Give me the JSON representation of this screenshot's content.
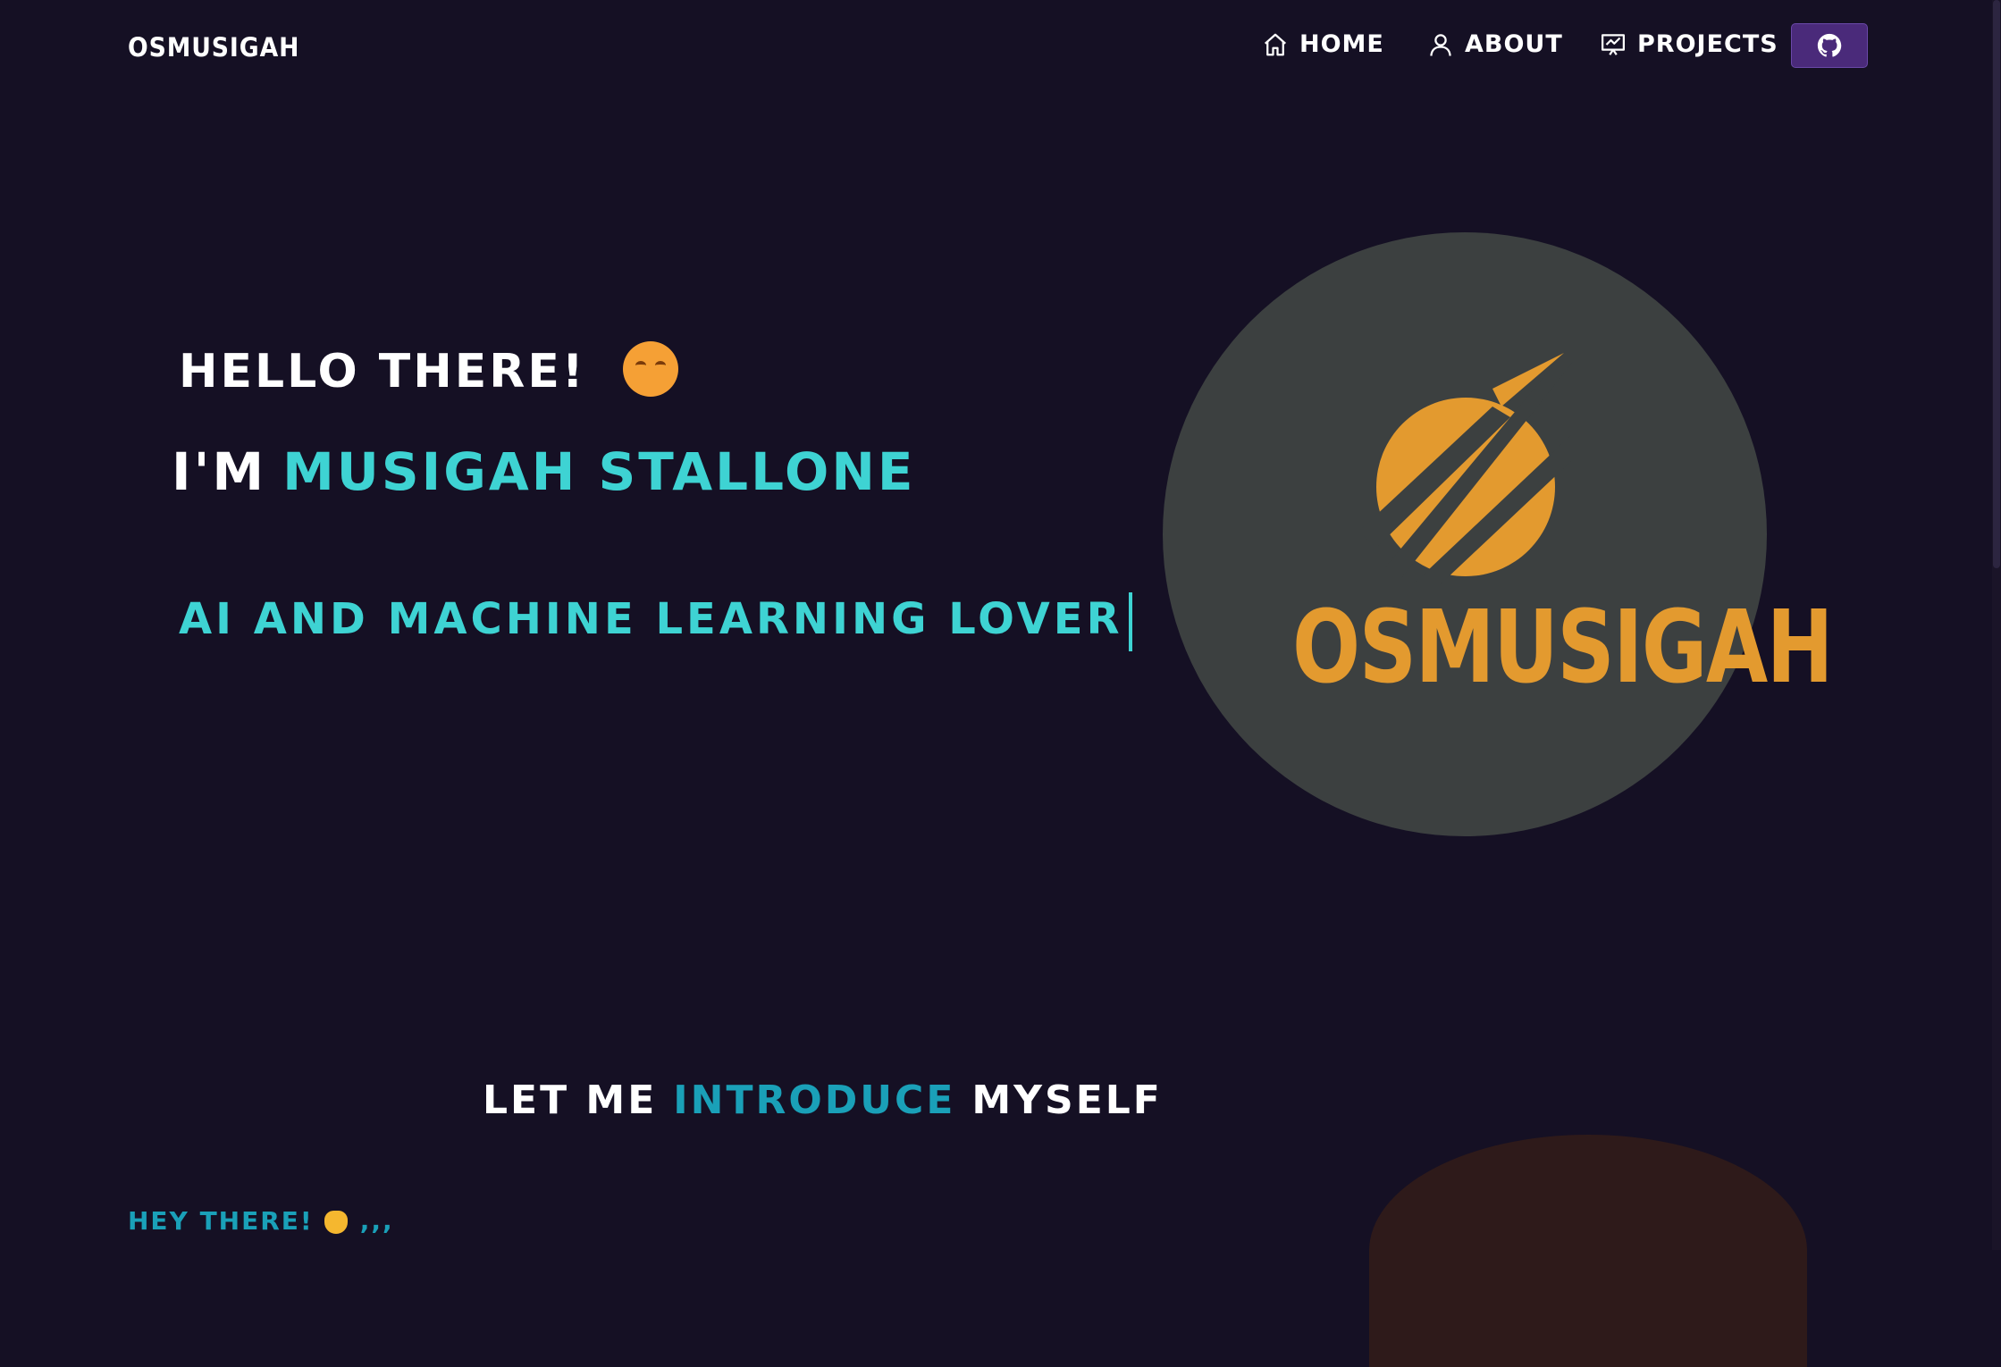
{
  "navbar": {
    "brand": "OSMUSIGAH",
    "items": [
      {
        "label": "HOME",
        "icon": "home-icon"
      },
      {
        "label": "ABOUT",
        "icon": "user-icon"
      },
      {
        "label": "PROJECTS",
        "icon": "projects-icon"
      }
    ],
    "github_icon": "github-icon"
  },
  "hero": {
    "greeting": "HELLO THERE!",
    "greeting_emoji": "hugging-face-emoji",
    "im_prefix": "I'M",
    "name": "MUSIGAH STALLONE",
    "typewriter_text": "AI AND MACHINE LEARNING LOVER",
    "logo_text": "OSMUSIGAH"
  },
  "intro": {
    "heading_pre": "LET ME",
    "heading_accent": "INTRODUCE",
    "heading_post": "MYSELF",
    "greeting": "HEY THERE!",
    "greeting_suffix": ",,,"
  },
  "colors": {
    "background": "#151024",
    "accent_cyan": "#3ed3d3",
    "accent_teal": "#1aa0b8",
    "logo_orange": "#e39a2f",
    "logo_circle": "#3c4040",
    "github_button": "#4a2a7a"
  }
}
